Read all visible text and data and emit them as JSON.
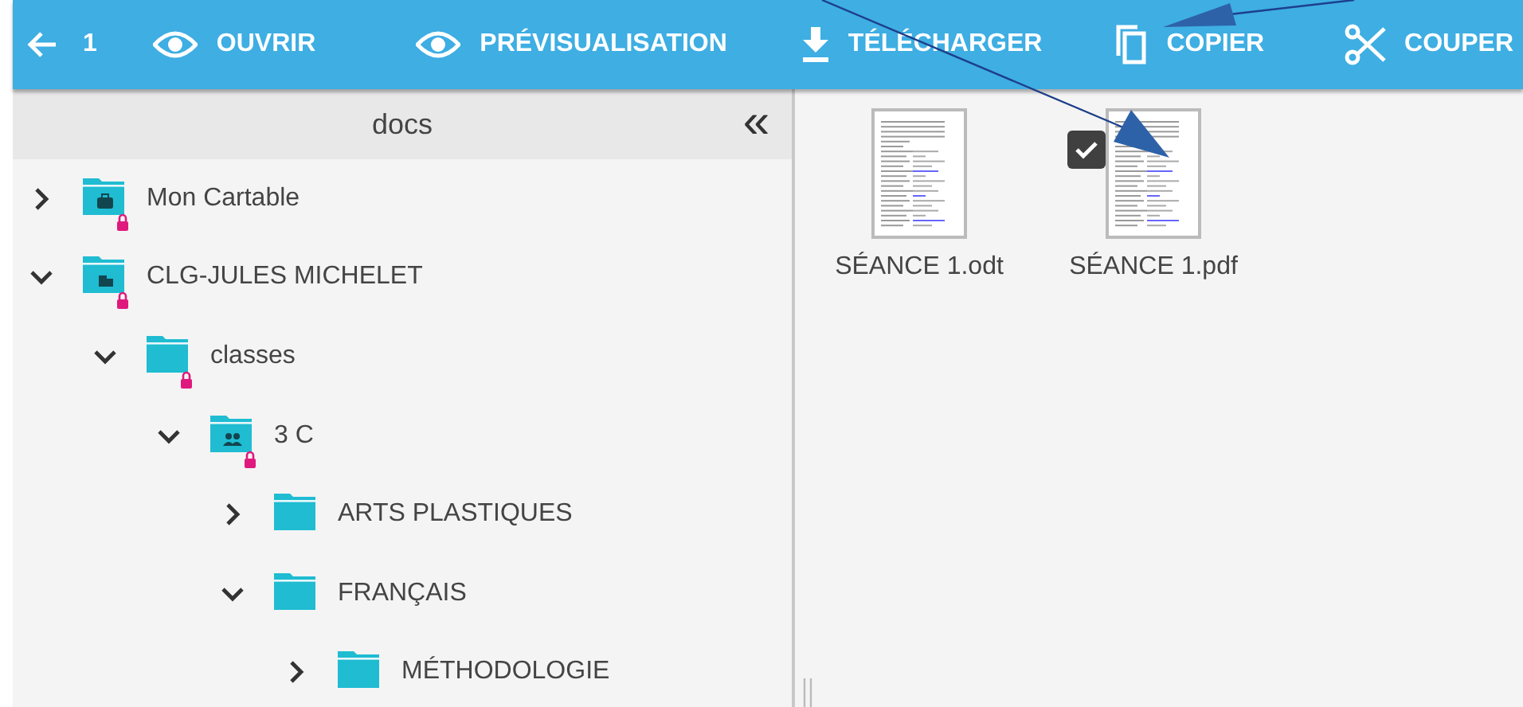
{
  "toolbar": {
    "back": {
      "count": "1"
    },
    "actions": [
      {
        "kind": "eye",
        "label": "OUVRIR"
      },
      {
        "kind": "eye",
        "label": "PRÉVISUALISATION"
      },
      {
        "kind": "download",
        "label": "TÉLÉCHARGER"
      },
      {
        "kind": "copy",
        "label": "COPIER"
      },
      {
        "kind": "scissors",
        "label": "COUPER"
      }
    ]
  },
  "sidebar": {
    "title": "docs",
    "collapse_glyph": "«"
  },
  "tree": [
    {
      "label": "Mon Cartable",
      "kind": "briefcase",
      "locked": true,
      "expanded": false
    },
    {
      "label": "CLG-JULES MICHELET",
      "kind": "building",
      "locked": true,
      "expanded": true,
      "children": [
        {
          "label": "classes",
          "kind": "plain",
          "locked": true,
          "expanded": true,
          "children": [
            {
              "label": "3 C",
              "kind": "group",
              "locked": true,
              "expanded": true,
              "children": [
                {
                  "label": "ARTS PLASTIQUES",
                  "kind": "plain",
                  "locked": false,
                  "expanded": false
                },
                {
                  "label": "FRANÇAIS",
                  "kind": "plain",
                  "locked": false,
                  "expanded": true,
                  "children": [
                    {
                      "label": "MÉTHODOLOGIE",
                      "kind": "plain",
                      "locked": false,
                      "expanded": false
                    }
                  ]
                }
              ]
            }
          ]
        }
      ]
    }
  ],
  "files": [
    {
      "name": "SÉANCE 1.odt",
      "selected": false
    },
    {
      "name": "SÉANCE 1.pdf",
      "selected": true
    }
  ]
}
